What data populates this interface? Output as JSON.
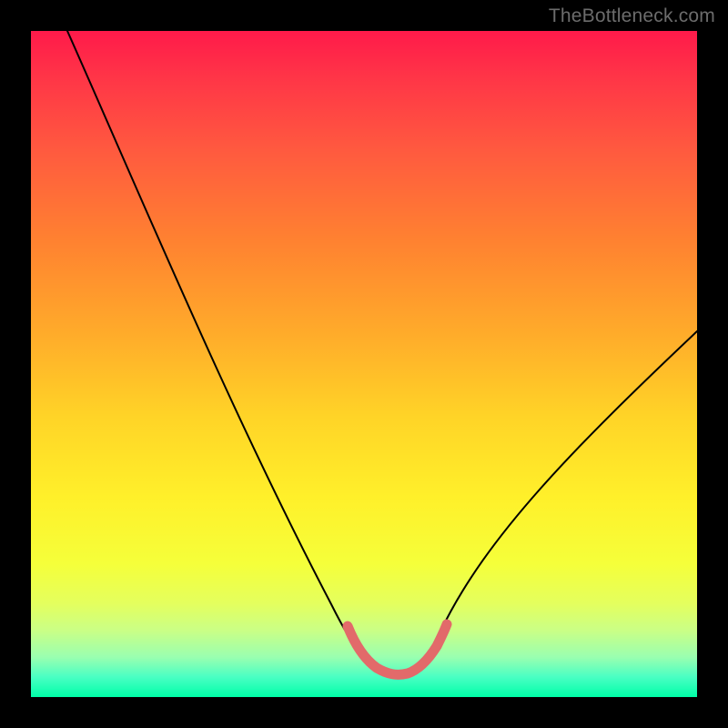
{
  "watermark": {
    "text": "TheBottleneck.com"
  },
  "chart_data": {
    "type": "line",
    "title": "",
    "xlabel": "",
    "ylabel": "",
    "xlim": [
      0,
      100
    ],
    "ylim": [
      0,
      100
    ],
    "grid": false,
    "legend": false,
    "series": [
      {
        "name": "bottleneck-curve",
        "x": [
          6,
          10,
          15,
          20,
          25,
          30,
          35,
          40,
          45,
          48,
          50,
          52,
          55,
          57,
          60,
          63,
          66,
          70,
          75,
          80,
          85,
          90,
          95,
          100
        ],
        "values": [
          100,
          91,
          80,
          69,
          59,
          49,
          39,
          29,
          18,
          10,
          5,
          3,
          2,
          2,
          3,
          5,
          10,
          17,
          24,
          31,
          38,
          44,
          50,
          55
        ]
      },
      {
        "name": "optimal-range-marker",
        "x": [
          48,
          49.5,
          51,
          53,
          55,
          57,
          58.5,
          60,
          61,
          61.8
        ],
        "values": [
          10.5,
          7.5,
          5.2,
          3.5,
          3.0,
          3.2,
          4.0,
          5.4,
          7.2,
          9.5
        ]
      }
    ],
    "background_gradient": {
      "top": "#ff1a4a",
      "mid": "#ffd427",
      "bottom": "#00ffa8"
    }
  }
}
